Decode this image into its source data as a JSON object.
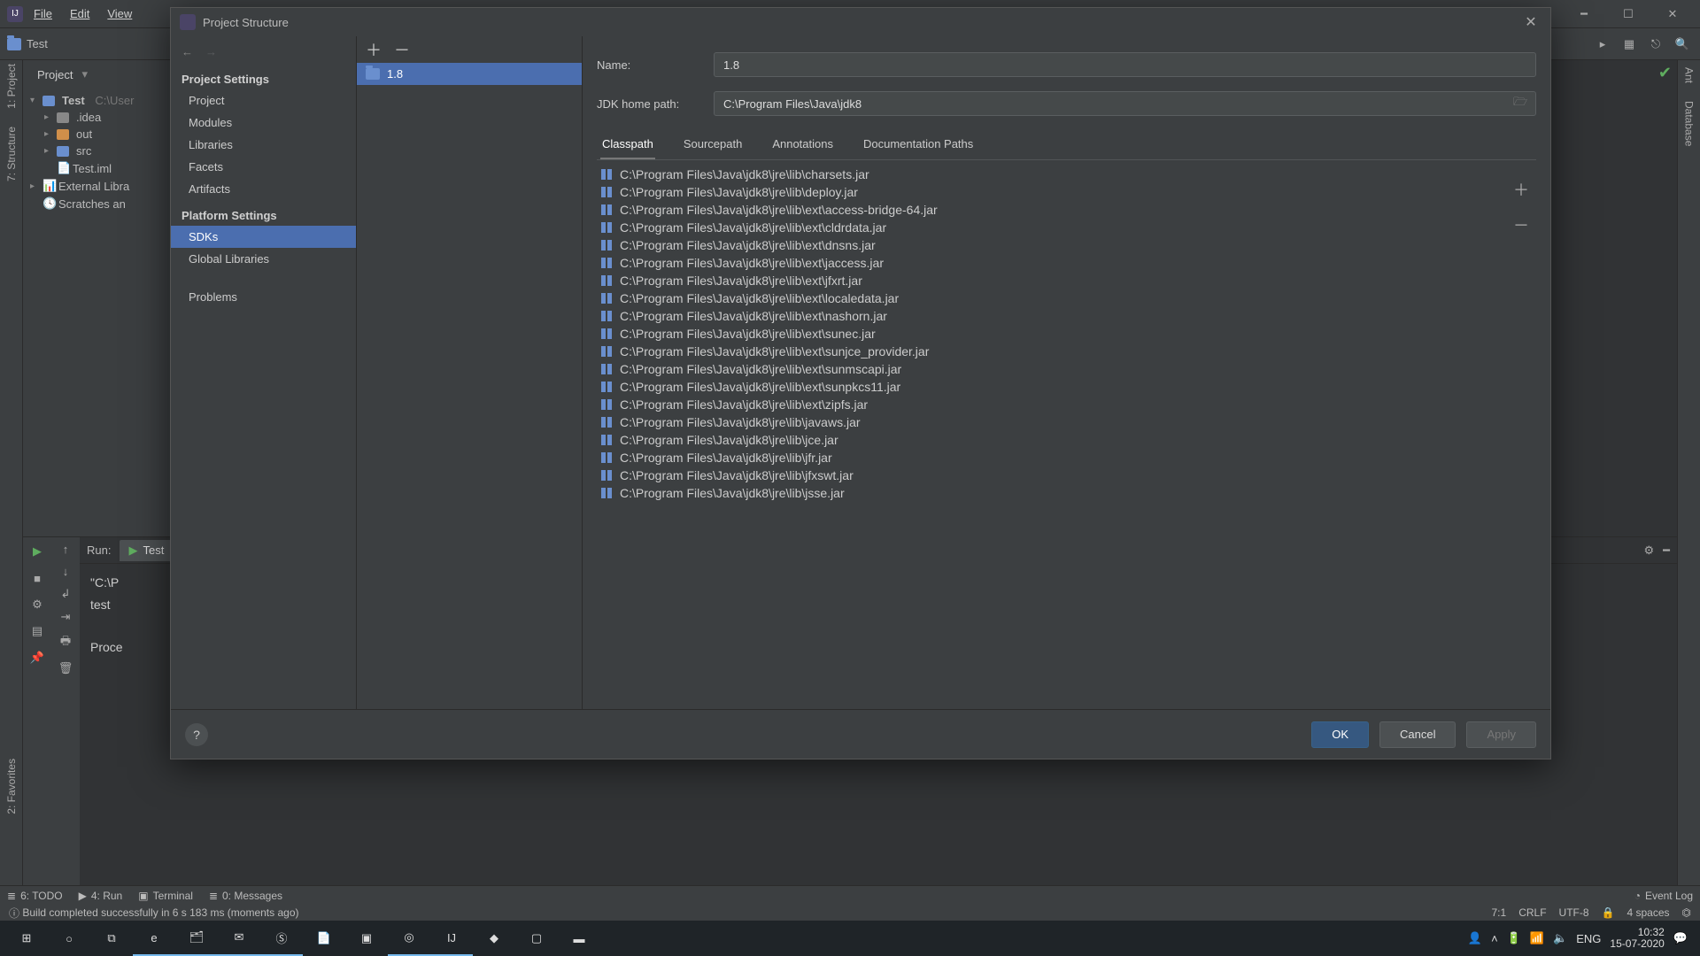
{
  "menubar": {
    "items": [
      "File",
      "Edit",
      "View"
    ]
  },
  "toolbar": {
    "project_name": "Test"
  },
  "project_tree": {
    "header": "Project",
    "root": "Test",
    "root_path": "C:\\User",
    "nodes": {
      "idea": ".idea",
      "out": "out",
      "src": "src",
      "iml": "Test.iml",
      "external": "External Libra",
      "scratches": "Scratches an"
    }
  },
  "dialog": {
    "title": "Project Structure",
    "nav_groups": {
      "project_settings": "Project Settings",
      "platform_settings": "Platform Settings"
    },
    "nav_items": {
      "project": "Project",
      "modules": "Modules",
      "libraries": "Libraries",
      "facets": "Facets",
      "artifacts": "Artifacts",
      "sdks": "SDKs",
      "global_libs": "Global Libraries",
      "problems": "Problems"
    },
    "sdk_entry": "1.8",
    "name_label": "Name:",
    "name_value": "1.8",
    "jdk_label": "JDK home path:",
    "jdk_value": "C:\\Program Files\\Java\\jdk8",
    "tabs": {
      "classpath": "Classpath",
      "sourcepath": "Sourcepath",
      "annotations": "Annotations",
      "docs": "Documentation Paths"
    },
    "jars": [
      "C:\\Program Files\\Java\\jdk8\\jre\\lib\\charsets.jar",
      "C:\\Program Files\\Java\\jdk8\\jre\\lib\\deploy.jar",
      "C:\\Program Files\\Java\\jdk8\\jre\\lib\\ext\\access-bridge-64.jar",
      "C:\\Program Files\\Java\\jdk8\\jre\\lib\\ext\\cldrdata.jar",
      "C:\\Program Files\\Java\\jdk8\\jre\\lib\\ext\\dnsns.jar",
      "C:\\Program Files\\Java\\jdk8\\jre\\lib\\ext\\jaccess.jar",
      "C:\\Program Files\\Java\\jdk8\\jre\\lib\\ext\\jfxrt.jar",
      "C:\\Program Files\\Java\\jdk8\\jre\\lib\\ext\\localedata.jar",
      "C:\\Program Files\\Java\\jdk8\\jre\\lib\\ext\\nashorn.jar",
      "C:\\Program Files\\Java\\jdk8\\jre\\lib\\ext\\sunec.jar",
      "C:\\Program Files\\Java\\jdk8\\jre\\lib\\ext\\sunjce_provider.jar",
      "C:\\Program Files\\Java\\jdk8\\jre\\lib\\ext\\sunmscapi.jar",
      "C:\\Program Files\\Java\\jdk8\\jre\\lib\\ext\\sunpkcs11.jar",
      "C:\\Program Files\\Java\\jdk8\\jre\\lib\\ext\\zipfs.jar",
      "C:\\Program Files\\Java\\jdk8\\jre\\lib\\javaws.jar",
      "C:\\Program Files\\Java\\jdk8\\jre\\lib\\jce.jar",
      "C:\\Program Files\\Java\\jdk8\\jre\\lib\\jfr.jar",
      "C:\\Program Files\\Java\\jdk8\\jre\\lib\\jfxswt.jar",
      "C:\\Program Files\\Java\\jdk8\\jre\\lib\\jsse.jar"
    ],
    "buttons": {
      "ok": "OK",
      "cancel": "Cancel",
      "apply": "Apply",
      "help": "?"
    }
  },
  "run": {
    "label": "Run:",
    "tab": "Test",
    "console_line1": "\"C:\\P",
    "console_line2": "test",
    "console_line3": "Proce"
  },
  "bottom": {
    "todo": "6: TODO",
    "run": "4: Run",
    "terminal": "Terminal",
    "messages": "0: Messages",
    "eventlog": "Event Log"
  },
  "status": {
    "msg": "Build completed successfully in 6 s 183 ms (moments ago)",
    "pos": "7:1",
    "crlf": "CRLF",
    "encoding": "UTF-8",
    "indent": "4 spaces"
  },
  "left_tool": {
    "project": "1: Project",
    "structure": "7: Structure",
    "favorites": "2: Favorites"
  },
  "right_tool": {
    "ant": "Ant",
    "database": "Database"
  },
  "taskbar": {
    "lang": "ENG",
    "time": "10:32",
    "date": "15-07-2020"
  }
}
